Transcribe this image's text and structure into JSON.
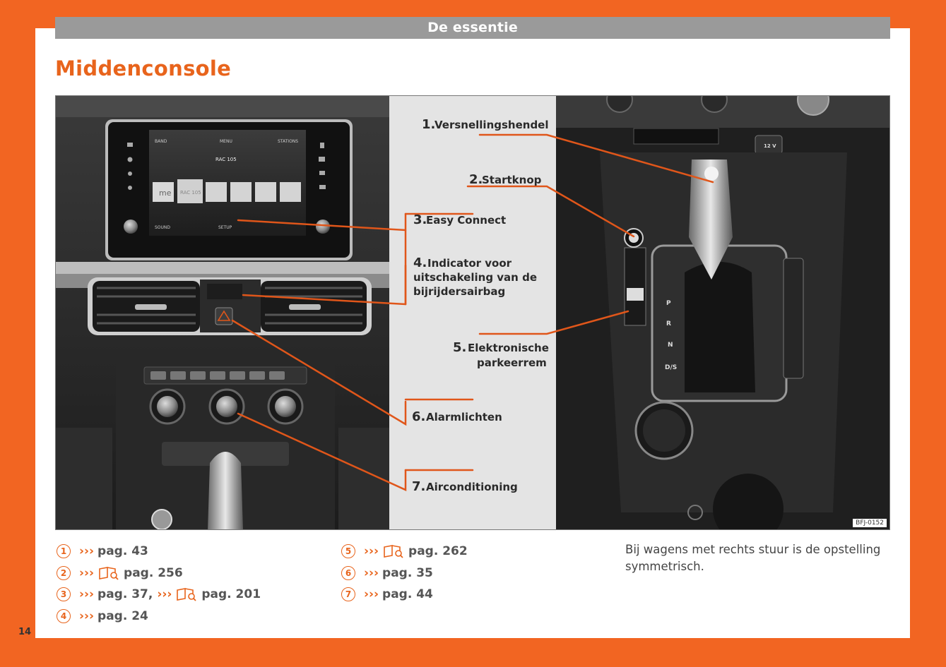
{
  "header": {
    "section": "De essentie"
  },
  "page": {
    "title": "Middenconsole",
    "number": "14"
  },
  "figure": {
    "code": "BFJ-0152",
    "screen": {
      "tabs": [
        "BAND",
        "MENU",
        "STATIONS"
      ],
      "station": "RAC 105",
      "soft_keys": [
        "SOUND",
        "SETUP"
      ],
      "presets": [
        "me",
        "RAC 105"
      ]
    },
    "callouts": [
      {
        "number": "1.",
        "lines": [
          "Versnellingshendel"
        ]
      },
      {
        "number": "2.",
        "lines": [
          "Startknop"
        ]
      },
      {
        "number": "3.",
        "lines": [
          "Easy Connect"
        ]
      },
      {
        "number": "4.",
        "lines": [
          "Indicator voor",
          "uitschakeling van de",
          "bijrijdersairbag"
        ]
      },
      {
        "number": "5.",
        "lines": [
          "Elektronische",
          "parkeerrem"
        ]
      },
      {
        "number": "6.",
        "lines": [
          "Alarmlichten"
        ]
      },
      {
        "number": "7.",
        "lines": [
          "Airconditioning"
        ]
      }
    ],
    "gear_labels": [
      "P",
      "R",
      "N",
      "D/S"
    ],
    "socket_label": "12 V"
  },
  "references": {
    "prefix": "›››",
    "col1": [
      {
        "num": "1",
        "parts": [
          "pag. 43"
        ]
      },
      {
        "num": "2",
        "book": true,
        "parts": [
          "pag. 256"
        ]
      },
      {
        "num": "3",
        "parts": [
          "pag. 37,",
          "pag. 201"
        ],
        "book_second": true
      },
      {
        "num": "4",
        "parts": [
          "pag. 24"
        ]
      }
    ],
    "col2": [
      {
        "num": "5",
        "book": true,
        "parts": [
          "pag. 262"
        ]
      },
      {
        "num": "6",
        "parts": [
          "pag. 35"
        ]
      },
      {
        "num": "7",
        "parts": [
          "pag. 44"
        ]
      }
    ]
  },
  "note": "Bij wagens met rechts stuur is de opstelling symmetrisch.",
  "colors": {
    "accent": "#f26522",
    "title": "#e8641c",
    "band": "#9a9a9a",
    "callout_line": "#e0561a"
  }
}
